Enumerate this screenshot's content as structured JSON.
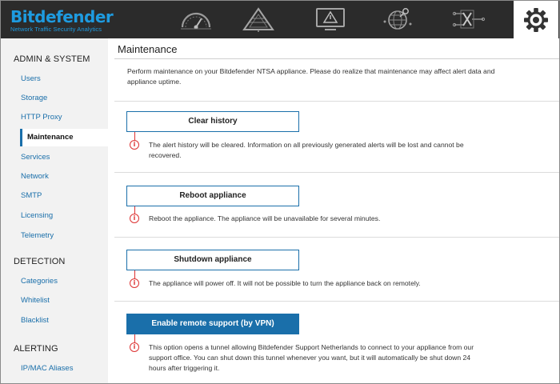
{
  "brand": {
    "name": "Bitdefender",
    "tagline": "Network Traffic Security Analytics"
  },
  "topnav": [
    {
      "icon": "dashboard-gauge-icon"
    },
    {
      "icon": "network-threat-icon"
    },
    {
      "icon": "alert-monitor-icon"
    },
    {
      "icon": "global-network-icon"
    },
    {
      "icon": "circuit-investigation-icon"
    },
    {
      "icon": "gear-icon",
      "active": true
    }
  ],
  "sidebar": {
    "sections": [
      {
        "title": "ADMIN & SYSTEM",
        "items": [
          "Users",
          "Storage",
          "HTTP Proxy",
          "Maintenance",
          "Services",
          "Network",
          "SMTP",
          "Licensing",
          "Telemetry"
        ]
      },
      {
        "title": "DETECTION",
        "items": [
          "Categories",
          "Whitelist",
          "Blacklist"
        ]
      },
      {
        "title": "ALERTING",
        "items": [
          "IP/MAC Aliases"
        ]
      }
    ],
    "active_item": "Maintenance"
  },
  "main": {
    "title": "Maintenance",
    "intro": "Perform maintenance on your Bitdefender NTSA appliance. Please do realize that maintenance may affect alert data and appliance uptime.",
    "actions": [
      {
        "label": "Clear history",
        "description": "The alert history will be cleared. Information on all previously generated alerts will be lost and cannot be recovered.",
        "primary": false
      },
      {
        "label": "Reboot appliance",
        "description": "Reboot the appliance. The appliance will be unavailable for several minutes.",
        "primary": false
      },
      {
        "label": "Shutdown appliance",
        "description": "The appliance will power off. It will not be possible to turn the appliance back on remotely.",
        "primary": false
      },
      {
        "label": "Enable remote support (by VPN)",
        "description": "This option opens a tunnel allowing Bitdefender Support Netherlands to connect to your appliance from our support office. You can shut down this tunnel whenever you want, but it will automatically be shut down 24 hours after triggering it.",
        "primary": true
      }
    ],
    "info_glyph": "i"
  },
  "colors": {
    "accent": "#1a6faa",
    "brand": "#1e9be0",
    "topbar": "#2b2b2b",
    "warning": "#dd3333",
    "sidebar_bg": "#f2f2f2"
  }
}
